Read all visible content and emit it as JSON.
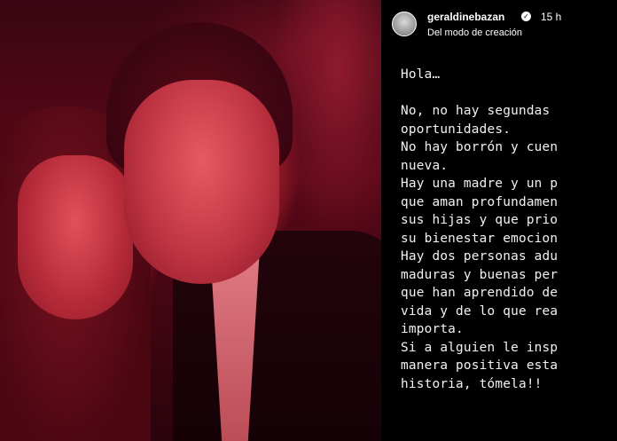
{
  "photo": {
    "description_icon": "photo-image"
  },
  "story": {
    "username": "geraldinebazan",
    "verified_icon": "verified-badge-icon",
    "time": "15 h",
    "subtitle": "Del modo de creación",
    "lines": [
      "Hola…",
      "",
      "No, no hay segundas",
      "oportunidades.",
      "No hay borrón y cuen",
      "nueva.",
      "Hay una madre y un p",
      "que aman profundamen",
      "sus hijas y que prio",
      "su bienestar emocion",
      "Hay dos personas adu",
      "maduras y buenas per",
      "que han aprendido de",
      "vida y de lo que rea",
      "importa.",
      "Si a alguien le insp",
      "manera positiva esta",
      "historia, tómela!!"
    ]
  },
  "colors": {
    "story_bg": "#000000",
    "text": "#f2f2f2",
    "photo_tint": "#c2303e"
  }
}
